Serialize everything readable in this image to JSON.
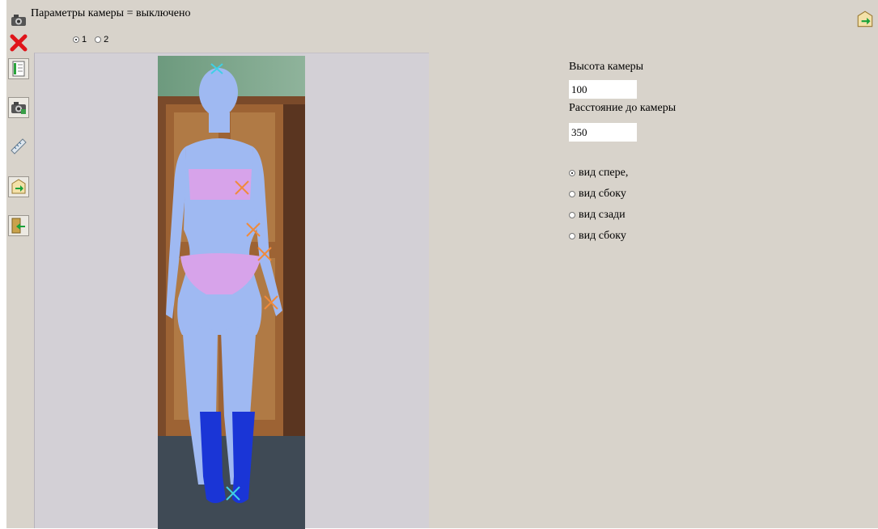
{
  "title": "Параметры камеры = выключено",
  "view_selector": {
    "options": [
      {
        "label": "1",
        "selected": true
      },
      {
        "label": "2",
        "selected": false
      }
    ]
  },
  "camera": {
    "height_label": "Высота камеры",
    "height_value": "100",
    "distance_label": "Расстояние до камеры",
    "distance_value": "350"
  },
  "view_options": [
    {
      "label": "вид спере,",
      "selected": true
    },
    {
      "label": "вид сбоку",
      "selected": false
    },
    {
      "label": "вид сзади",
      "selected": false
    },
    {
      "label": "вид сбоку",
      "selected": false
    }
  ],
  "toolbar": [
    {
      "name": "camera-icon"
    },
    {
      "name": "close-icon"
    },
    {
      "name": "document-icon"
    },
    {
      "name": "camera-settings-icon"
    },
    {
      "name": "measure-icon"
    },
    {
      "name": "export-icon"
    },
    {
      "name": "import-icon"
    }
  ],
  "colors": {
    "background": "#d8d3cb",
    "body": "#9fb9f2",
    "underwear": "#d7a3ea",
    "boots": "#1a35d6",
    "marker_cyan": "#3fd0e6",
    "marker_orange": "#f08a3c"
  }
}
